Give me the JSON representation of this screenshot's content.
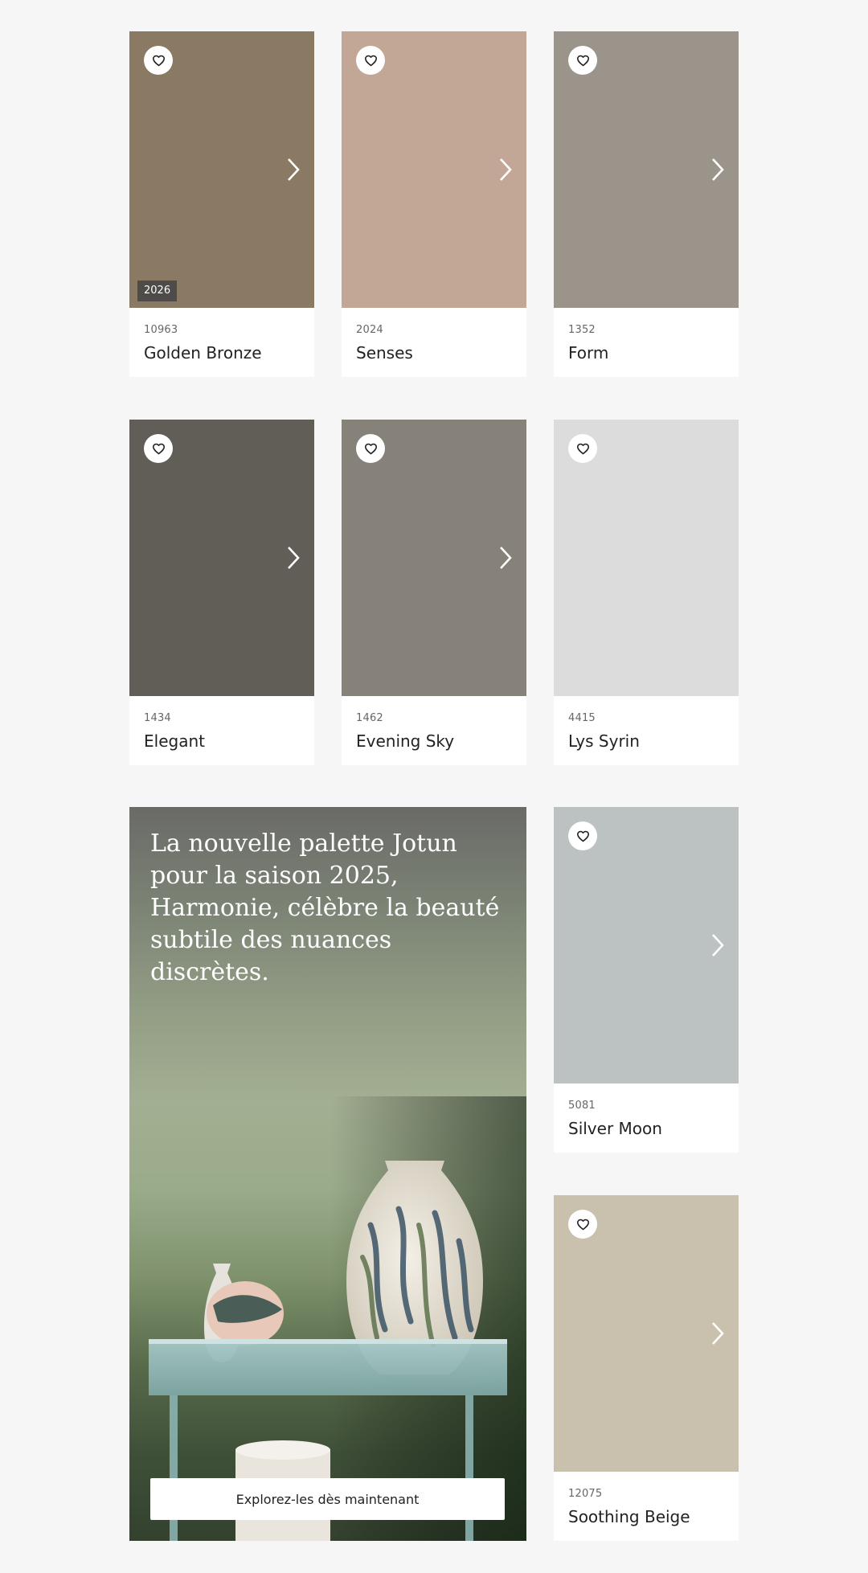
{
  "cards": [
    {
      "code": "10963",
      "name": "Golden Bronze",
      "color": "#8b7a63",
      "badge": "2026"
    },
    {
      "code": "2024",
      "name": "Senses",
      "color": "#c2a796"
    },
    {
      "code": "1352",
      "name": "Form",
      "color": "#9b948a"
    },
    {
      "code": "1434",
      "name": "Elegant",
      "color": "#615d57"
    },
    {
      "code": "1462",
      "name": "Evening Sky",
      "color": "#868279"
    },
    {
      "code": "4415",
      "name": "Lys Syrin",
      "color": "#dcdcdc"
    },
    {
      "code": "5081",
      "name": "Silver Moon",
      "color": "#bcc1c1"
    },
    {
      "code": "12075",
      "name": "Soothing Beige",
      "color": "#cac0ae"
    }
  ],
  "promo": {
    "title": "La nouvelle palette Jotun pour la saison 2025, Harmonie, célèbre la beauté subtile des nuances discrètes.",
    "cta_label": "Explorez-les dès maintenant"
  },
  "icons": {
    "favorite": "heart-outline-icon",
    "next": "chevron-right-icon"
  }
}
